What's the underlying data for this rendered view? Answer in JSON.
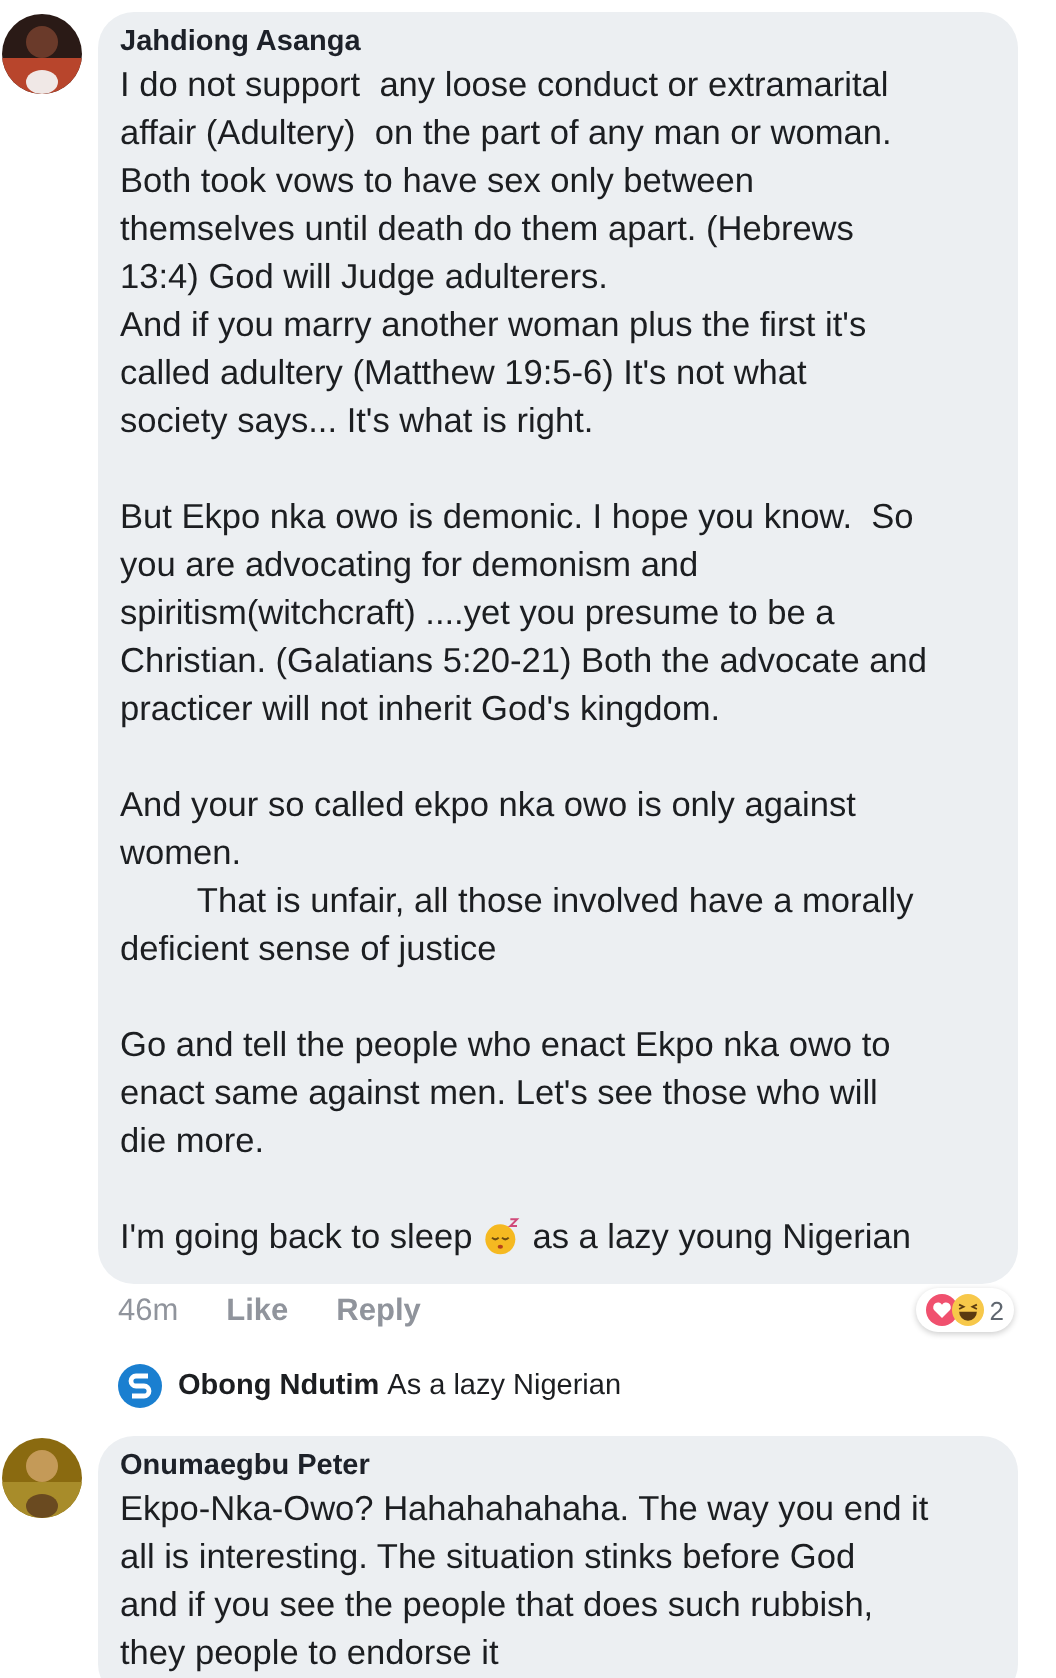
{
  "comments": [
    {
      "author": "Jahdiong Asanga",
      "avatar": {
        "kind": "picture"
      },
      "paragraphs": [
        "I do not support  any loose conduct or extramarital\naffair (Adultery)  on the part of any man or woman.\nBoth took vows to have sex only between\nthemselves until death do them apart. (Hebrews\n13:4) God will Judge adulterers.\nAnd if you marry another woman plus the first it's\ncalled adultery (Matthew 19:5-6) It's not what\nsociety says... It's what is right.",
        "But Ekpo nka owo is demonic. I hope you know.  So\nyou are advocating for demonism and\nspiritism(witchcraft) ....yet you presume to be a\nChristian. (Galatians 5:20-21) Both the advocate and\npracticer will not inherit God's kingdom.",
        "And your so called ekpo nka owo is only against\nwomen.\n        That is unfair, all those involved have a morally\ndeficient sense of justice",
        "Go and tell the people who enact Ekpo nka owo to\nenact same against men. Let's see those who will\ndie more."
      ],
      "closing_line": {
        "before": "I'm going back to sleep",
        "after": "as a lazy young Nigerian"
      },
      "time": "46m",
      "actions": [
        "Like",
        "Reply"
      ],
      "reaction_count": "2",
      "reply_preview": {
        "author": "Obong Ndutim",
        "text": "As a lazy Nigerian"
      }
    },
    {
      "author": "Onumaegbu Peter",
      "avatar": {
        "kind": "picture"
      },
      "paragraphs": [
        "Ekpo-Nka-Owo? Hahahahahaha. The way you end it\nall is interesting. The situation stinks before God\nand if you see the people that does such rubbish,\nthey people to endorse it"
      ]
    }
  ]
}
